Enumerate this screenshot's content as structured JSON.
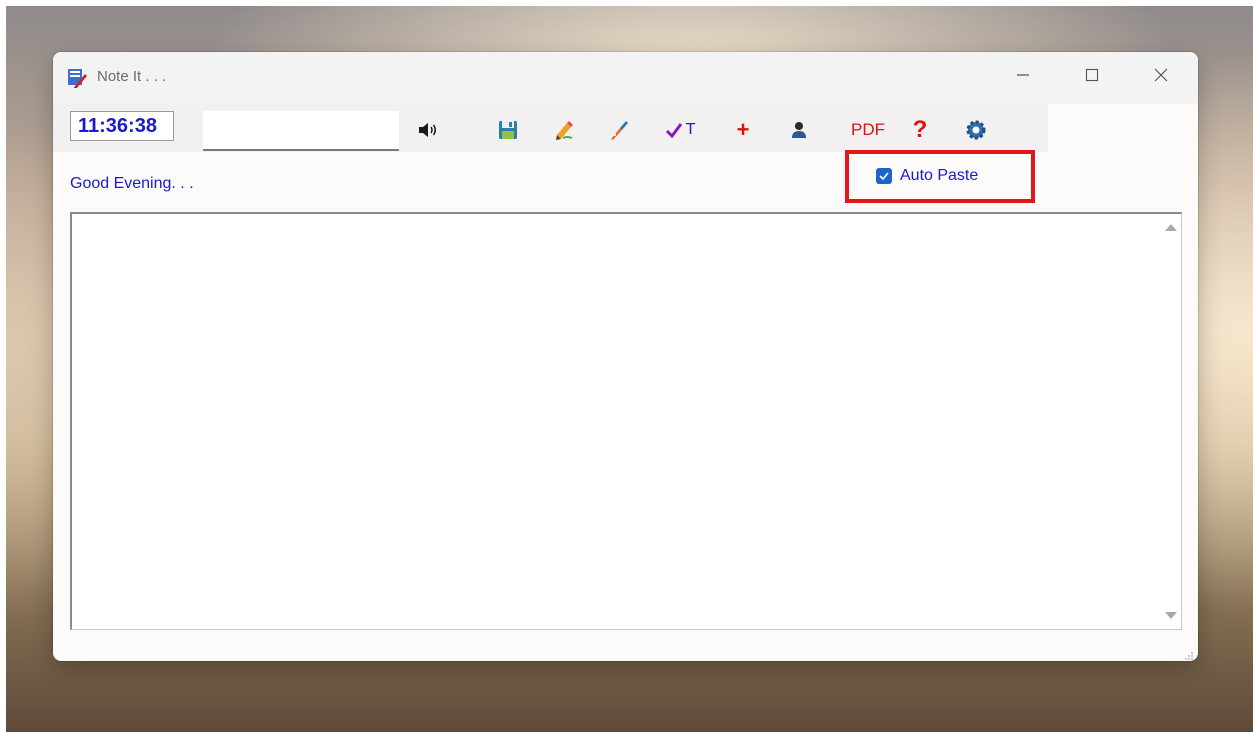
{
  "window": {
    "title": "Note It . . .",
    "controls": {
      "minimize": "minimize-icon",
      "maximize": "maximize-icon",
      "close": "close-icon"
    }
  },
  "toolbar": {
    "clock": "11:36:38",
    "input_value": "",
    "pdf_label": "PDF",
    "help_label": "?",
    "plus_label": "+",
    "tasks_label": "T",
    "icons": [
      "speaker-icon",
      "save-icon",
      "edit-pencil-icon",
      "brush-icon",
      "check-text-icon",
      "add-icon",
      "user-icon",
      "pdf-icon",
      "help-icon",
      "settings-icon"
    ]
  },
  "greeting": "Good Evening. . .",
  "auto_paste": {
    "label": "Auto Paste",
    "checked": true
  },
  "editor": {
    "content": ""
  },
  "colors": {
    "accent_blue": "#1a1acc",
    "highlight_red": "#e3151a",
    "checkbox_blue": "#1f64c8"
  }
}
